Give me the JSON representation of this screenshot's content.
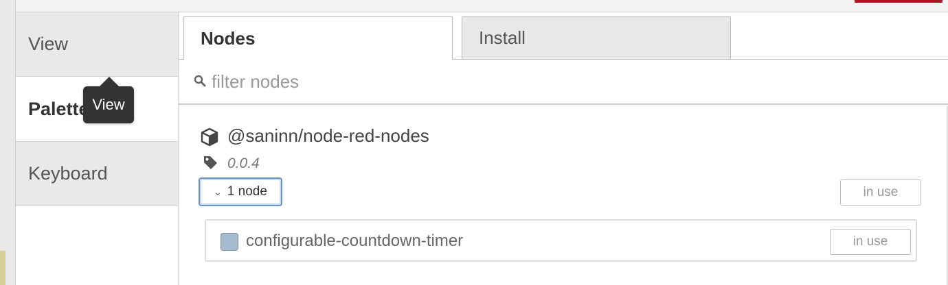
{
  "sidebar": {
    "items": [
      {
        "label": "View"
      },
      {
        "label": "Palette"
      },
      {
        "label": "Keyboard"
      }
    ]
  },
  "tooltip": {
    "text": "View"
  },
  "tabs": [
    {
      "label": "Nodes"
    },
    {
      "label": "Install"
    }
  ],
  "filter": {
    "placeholder": "filter nodes",
    "value": ""
  },
  "package": {
    "name": "@saninn/node-red-nodes",
    "version": "0.0.4",
    "expand_label": "1 node",
    "status_label": "in use",
    "nodes": [
      {
        "name": "configurable-countdown-timer",
        "status_label": "in use",
        "color": "#a6bbcf"
      }
    ]
  },
  "colors": {
    "accent_red": "#ad1625",
    "focus_blue": "#6b96c7"
  },
  "icons": [
    "search-icon",
    "package-icon",
    "tag-icon",
    "chevron-down-icon"
  ]
}
